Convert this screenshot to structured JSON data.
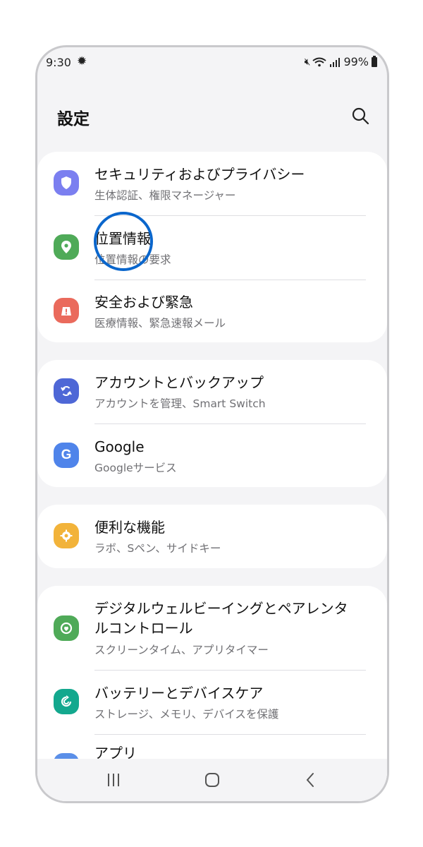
{
  "status": {
    "time": "9:30",
    "battery": "99%"
  },
  "header": {
    "title": "設定"
  },
  "groups": [
    {
      "items": [
        {
          "title": "セキュリティおよびプライバシー",
          "subtitle": "生体認証、権限マネージャー",
          "icon": "shield-icon",
          "color": "#7b7ff0"
        },
        {
          "title": "位置情報",
          "subtitle": "位置情報の要求",
          "icon": "location-pin-icon",
          "color": "#4faa58"
        },
        {
          "title": "安全および緊急",
          "subtitle": "医療情報、緊急速報メール",
          "icon": "emergency-icon",
          "color": "#ea6a5c"
        }
      ]
    },
    {
      "items": [
        {
          "title": "アカウントとバックアップ",
          "subtitle": "アカウントを管理、Smart Switch",
          "icon": "sync-icon",
          "color": "#4e67d6"
        },
        {
          "title": "Google",
          "subtitle": "Googleサービス",
          "icon": "google-icon",
          "color": "#4f84ea"
        }
      ]
    },
    {
      "items": [
        {
          "title": "便利な機能",
          "subtitle": "ラボ、Sペン、サイドキー",
          "icon": "advanced-features-icon",
          "color": "#f2b33a"
        }
      ]
    },
    {
      "items": [
        {
          "title": "デジタルウェルビーイングとペアレンタルコントロール",
          "title_line1": "デジタルウェルビーイングとペアレンタ",
          "title_line2": "ルコントロール",
          "subtitle": "スクリーンタイム、アプリタイマー",
          "icon": "digital-wellbeing-icon",
          "color": "#4faa58"
        },
        {
          "title": "バッテリーとデバイスケア",
          "subtitle": "ストレージ、メモリ、デバイスを保護",
          "icon": "device-care-icon",
          "color": "#13a88e"
        },
        {
          "title": "アプリ",
          "subtitle": "",
          "icon": "apps-icon",
          "color": "#5b8fe8"
        }
      ]
    }
  ],
  "annotation": {
    "highlight_color": "#0a66cc"
  },
  "navbar": {
    "recents": "|||",
    "home": "○",
    "back": "<"
  }
}
